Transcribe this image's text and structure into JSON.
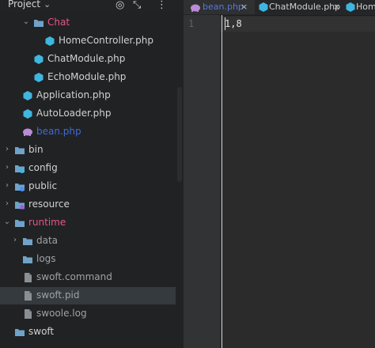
{
  "project": {
    "title": "Project",
    "tree": [
      {
        "label": "Chat",
        "icon": "folder-icon",
        "style": "pink",
        "arrow": "open",
        "depth": 2
      },
      {
        "label": "HomeController.php",
        "icon": "php-class-icon",
        "style": "normal",
        "depth": 3
      },
      {
        "label": "ChatModule.php",
        "icon": "php-class-icon",
        "style": "normal",
        "depth": 2
      },
      {
        "label": "EchoModule.php",
        "icon": "php-class-icon",
        "style": "normal",
        "depth": 2
      },
      {
        "label": "Application.php",
        "icon": "php-class-icon",
        "style": "normal",
        "depth": 1
      },
      {
        "label": "AutoLoader.php",
        "icon": "php-class-icon",
        "style": "normal",
        "depth": 1
      },
      {
        "label": "bean.php",
        "icon": "php-elephant-icon",
        "style": "blue",
        "depth": 1
      },
      {
        "label": "bin",
        "icon": "folder-icon",
        "style": "normal",
        "arrow": "closed",
        "depth": 0
      },
      {
        "label": "config",
        "icon": "folder-config-icon",
        "style": "normal",
        "arrow": "closed",
        "depth": 0
      },
      {
        "label": "public",
        "icon": "folder-public-icon",
        "style": "normal",
        "arrow": "closed",
        "depth": 0
      },
      {
        "label": "resource",
        "icon": "folder-resource-icon",
        "style": "normal",
        "arrow": "closed",
        "depth": 0
      },
      {
        "label": "runtime",
        "icon": "folder-icon",
        "style": "pink",
        "arrow": "open",
        "depth": 0
      },
      {
        "label": "data",
        "icon": "folder-icon",
        "style": "muted",
        "arrow": "closed",
        "depth": 1
      },
      {
        "label": "logs",
        "icon": "folder-icon",
        "style": "muted",
        "depth": 1
      },
      {
        "label": "swoft.command",
        "icon": "file-icon",
        "style": "muted",
        "depth": 1
      },
      {
        "label": "swoft.pid",
        "icon": "file-icon",
        "style": "muted",
        "depth": 1,
        "selected": true
      },
      {
        "label": "swoole.log",
        "icon": "file-icon",
        "style": "muted",
        "depth": 1
      },
      {
        "label": "swoft",
        "icon": "folder-icon",
        "style": "normal",
        "depth": 0
      }
    ]
  },
  "editor": {
    "tabs": [
      {
        "label": "bean.php",
        "icon": "php-elephant-icon",
        "active": true
      },
      {
        "label": "ChatModule.php",
        "icon": "php-class-icon",
        "active": false
      },
      {
        "label": "Hom",
        "icon": "php-class-icon",
        "active": false
      }
    ],
    "line_number": "1",
    "code_text": "1,8"
  },
  "colors": {
    "accent_pink": "#e8548e",
    "accent_blue": "#3f6ad8",
    "php_class_cyan": "#3fb6e0",
    "folder_blue": "#6fa3c9"
  }
}
